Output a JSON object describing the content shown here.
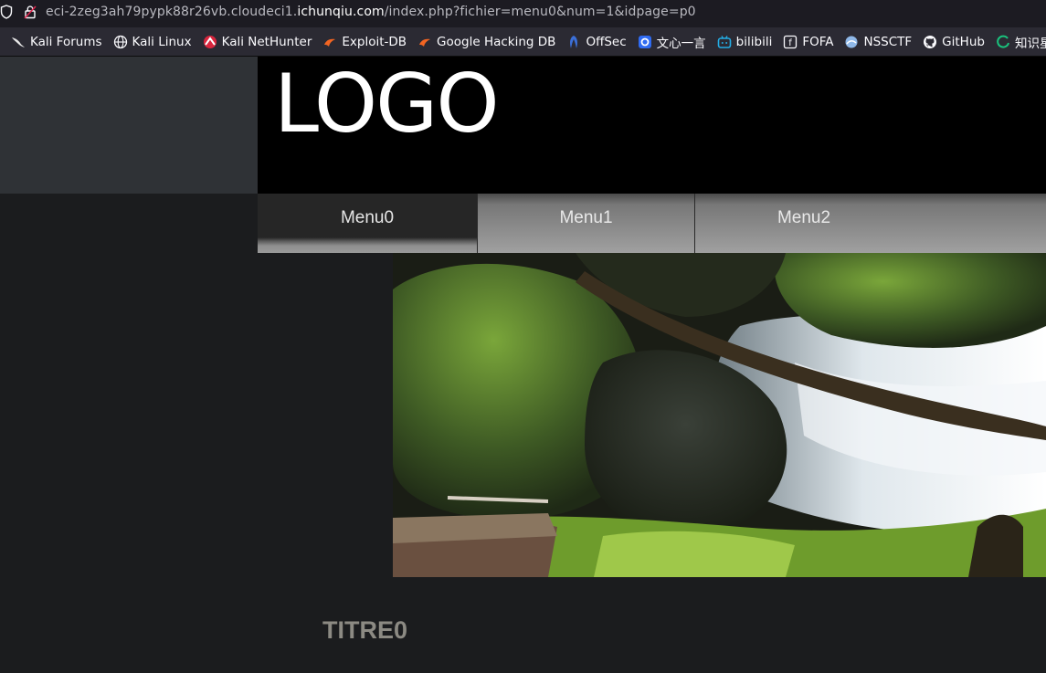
{
  "browser": {
    "url_prefix": "eci-2zeg3ah79pypk88r26vb.cloudeci1.",
    "url_domain": "ichunqiu.com",
    "url_suffix": "/index.php?fichier=menu0&num=1&idpage=p0"
  },
  "bookmarks": [
    {
      "label": "Kali Forums",
      "icon": "kali-dragon-icon"
    },
    {
      "label": "Kali Linux",
      "icon": "globe-icon"
    },
    {
      "label": "Kali NetHunter",
      "icon": "nethunter-icon"
    },
    {
      "label": "Exploit-DB",
      "icon": "exploitdb-icon"
    },
    {
      "label": "Google Hacking DB",
      "icon": "ghdb-icon"
    },
    {
      "label": "OffSec",
      "icon": "offsec-icon"
    },
    {
      "label": "文心一言",
      "icon": "wenxin-icon"
    },
    {
      "label": "bilibili",
      "icon": "bilibili-icon"
    },
    {
      "label": "FOFA",
      "icon": "fofa-icon"
    },
    {
      "label": "NSSCTF",
      "icon": "nssctf-icon"
    },
    {
      "label": "GitHub",
      "icon": "github-icon"
    },
    {
      "label": "知识星球",
      "icon": "zsxq-icon"
    }
  ],
  "page": {
    "logo": "LOGO",
    "menu": [
      {
        "label": "Menu0",
        "active": true
      },
      {
        "label": "Menu1",
        "active": false
      },
      {
        "label": "Menu2",
        "active": false
      }
    ],
    "title": "TITRE0"
  },
  "colors": {
    "header_bg": "#000000",
    "left_panel_bg": "#2f3236",
    "page_bg": "#1b1c1e",
    "title_color": "#8c8a83"
  }
}
